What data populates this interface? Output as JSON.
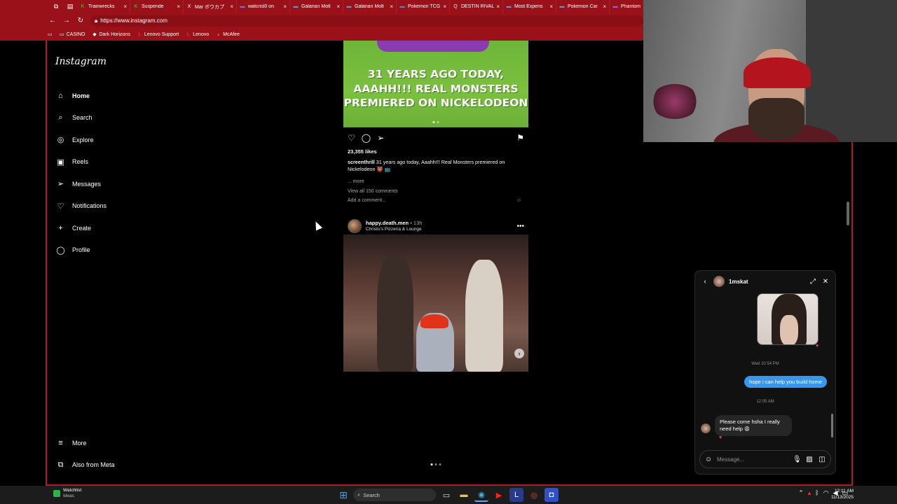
{
  "browser": {
    "tabs": [
      {
        "label": "Trainwrecks",
        "color": "#3fd13a",
        "icon": "K"
      },
      {
        "label": "Suspende",
        "color": "#3fd13a",
        "icon": "K"
      },
      {
        "label": "Mar ボウカプ",
        "color": "#ffffff",
        "icon": "X"
      },
      {
        "label": "watcrisl0 on",
        "color": "#8a6ad8",
        "icon": "▬"
      },
      {
        "label": "Galarian Molt",
        "color": "#5a9ad8",
        "icon": "▬"
      },
      {
        "label": "Galarian Molt",
        "color": "#5a9ad8",
        "icon": "▬"
      },
      {
        "label": "Pokemon TCG",
        "color": "#4a8ad8",
        "icon": "▬"
      },
      {
        "label": "DESTIN RIVAL",
        "color": "#e0e0e0",
        "icon": "Q"
      },
      {
        "label": "Most Expens",
        "color": "#5a9ad8",
        "icon": "▬"
      },
      {
        "label": "Pokemon Car",
        "color": "#5a9ad8",
        "icon": "▬"
      },
      {
        "label": "Phantom",
        "color": "#8a6ad8",
        "icon": "▬"
      }
    ],
    "url": "https://www.instagram.com",
    "bookmarks": [
      "CASINO",
      "Dark Horizons",
      "Lenovo Support",
      "Lenovo",
      "McAfee"
    ]
  },
  "sidebar": {
    "logo": "Instagram",
    "items": [
      {
        "label": "Home",
        "icon": "⌂",
        "name": "home"
      },
      {
        "label": "Search",
        "icon": "⌕",
        "name": "search"
      },
      {
        "label": "Explore",
        "icon": "◎",
        "name": "explore"
      },
      {
        "label": "Reels",
        "icon": "▣",
        "name": "reels"
      },
      {
        "label": "Messages",
        "icon": "➢",
        "name": "messages"
      },
      {
        "label": "Notifications",
        "icon": "♡",
        "name": "notifications"
      },
      {
        "label": "Create",
        "icon": "+",
        "name": "create"
      },
      {
        "label": "Profile",
        "icon": "◯",
        "name": "profile"
      }
    ],
    "bottom": [
      {
        "label": "More",
        "icon": "≡",
        "name": "more"
      },
      {
        "label": "Also from Meta",
        "icon": "⧉",
        "name": "also-from-meta"
      }
    ]
  },
  "post1": {
    "headline": "31 YEARS AGO TODAY, AAAHH!!! REAL MONSTERS PREMIERED ON NICKELODEON",
    "likes": "23,355 likes",
    "username": "screenthrill",
    "caption": "31 years ago today, Aaahh!!! Real Monsters premiered on Nickelodeon 👹 📺",
    "more": "... more",
    "view_comments": "View all 150 comments",
    "add_comment": "Add a comment..."
  },
  "post2": {
    "username": "happy.death.men",
    "time": "• 13h",
    "location": "Christo's Pizzeria & Lounge"
  },
  "dm": {
    "name": "1mskat",
    "time1": "Wed 10:54 PM",
    "outgoing": "hope i can help you build home",
    "time2": "12:05 AM",
    "incoming": "Please come hsha I really need help 😩",
    "placeholder": "Message..."
  },
  "taskbar": {
    "weather_title": "Watchlist",
    "weather_sub": "Ideas",
    "search": "Search",
    "time": "12:11 AM",
    "date": "11/13/2025"
  },
  "colors": {
    "chrome": "#9b1119",
    "accent_blue": "#3797f0",
    "post1_bg": "#74bb3c"
  }
}
